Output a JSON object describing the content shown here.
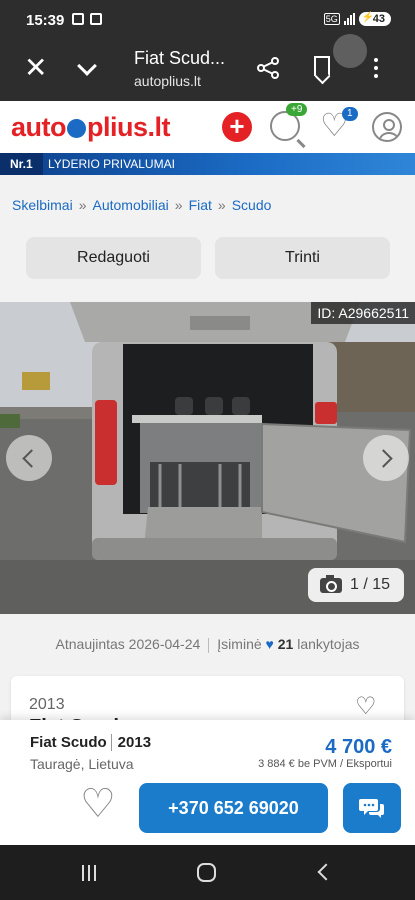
{
  "status_bar": {
    "time": "15:39",
    "network": "5G",
    "battery": "43"
  },
  "browser": {
    "title": "Fiat Scud...",
    "url": "autoplius.lt"
  },
  "site": {
    "logo_text": "autoplius.lt",
    "search_badge": "+9",
    "favorites_badge": "1",
    "nr1_label": "Nr.1",
    "nr1_text": "LYDERIO PRIVALUMAI",
    "accent_color": "#1b6bc4",
    "brand_red": "#e42226"
  },
  "breadcrumb": [
    "Skelbimai",
    "Automobiliai",
    "Fiat",
    "Scudo"
  ],
  "breadcrumb_separator": "»",
  "actions": {
    "edit_label": "Redaguoti",
    "delete_label": "Trinti"
  },
  "gallery": {
    "listing_id": "ID: A29662511",
    "counter": "1 / 15"
  },
  "meta": {
    "updated": "Atnaujintas 2026-04-24",
    "remembered": "Įsiminė",
    "visitors_count": "21",
    "visitors_label": "lankytojas"
  },
  "card": {
    "year": "2013",
    "title": "Fiat Scudo"
  },
  "sticky": {
    "model": "Fiat Scudo",
    "year": "2013",
    "location": "Tauragė, Lietuva",
    "price": "4 700 €",
    "price_note": "3 884 € be PVM / Eksportui",
    "phone": "+370 652 69020"
  }
}
